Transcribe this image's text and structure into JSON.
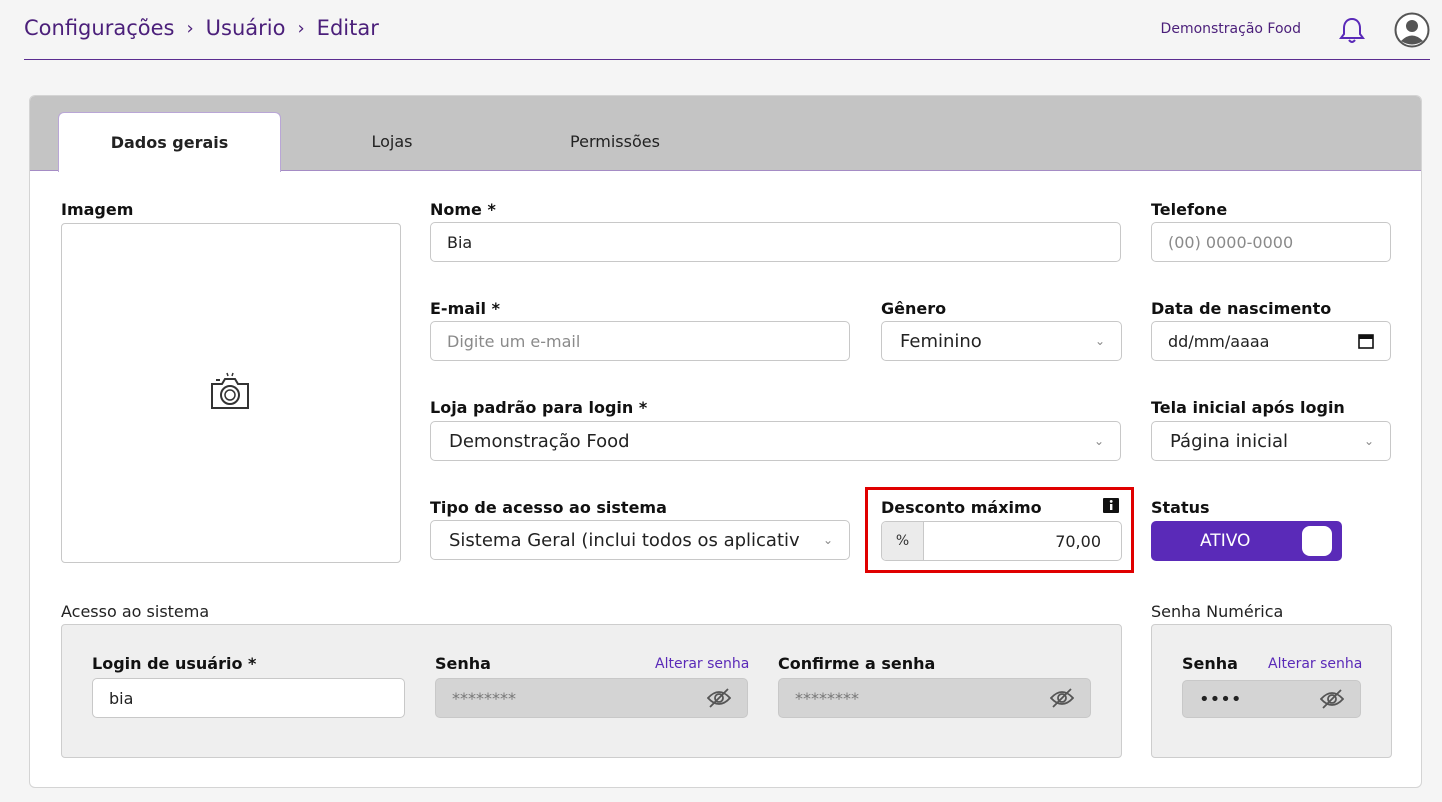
{
  "breadcrumb": {
    "items": [
      "Configurações",
      "Usuário",
      "Editar"
    ],
    "separator": "›"
  },
  "header": {
    "company": "Demonstração Food"
  },
  "tabs": [
    {
      "label": "Dados gerais",
      "active": true
    },
    {
      "label": "Lojas",
      "active": false
    },
    {
      "label": "Permissões",
      "active": false
    }
  ],
  "form": {
    "imagem_label": "Imagem",
    "nome": {
      "label": "Nome *",
      "value": "Bia"
    },
    "telefone": {
      "label": "Telefone",
      "placeholder": "(00) 0000-0000"
    },
    "email": {
      "label": "E-mail *",
      "placeholder": "Digite um e-mail"
    },
    "genero": {
      "label": "Gênero",
      "value": "Feminino"
    },
    "nascimento": {
      "label": "Data de nascimento",
      "value": "dd/mm/aaaa"
    },
    "loja": {
      "label": "Loja padrão para login *",
      "value": "Demonstração Food"
    },
    "tela": {
      "label": "Tela inicial após login",
      "value": "Página inicial"
    },
    "tipo": {
      "label": "Tipo de acesso ao sistema",
      "value": "Sistema Geral (inclui todos os aplicativ"
    },
    "desconto": {
      "label": "Desconto máximo",
      "prefix": "%",
      "value": "70,00"
    },
    "status": {
      "label": "Status",
      "value": "ATIVO",
      "on": true
    }
  },
  "acesso": {
    "title": "Acesso ao sistema",
    "login": {
      "label": "Login de usuário *",
      "value": "bia"
    },
    "senha": {
      "label": "Senha",
      "link": "Alterar senha",
      "value": "********"
    },
    "confirme": {
      "label": "Confirme a senha",
      "value": "********"
    }
  },
  "senha_numerica": {
    "title": "Senha Numérica",
    "senha": {
      "label": "Senha",
      "link": "Alterar senha",
      "value": "••••"
    }
  },
  "colors": {
    "brand": "#5a2ab8",
    "highlight": "#e00000",
    "tabbar": "#c4c4c4"
  },
  "icons": [
    "chevron-right-icon",
    "bell-icon",
    "user-avatar-icon",
    "camera-icon",
    "chevron-down-icon",
    "calendar-icon",
    "info-icon",
    "eye-slash-icon"
  ]
}
